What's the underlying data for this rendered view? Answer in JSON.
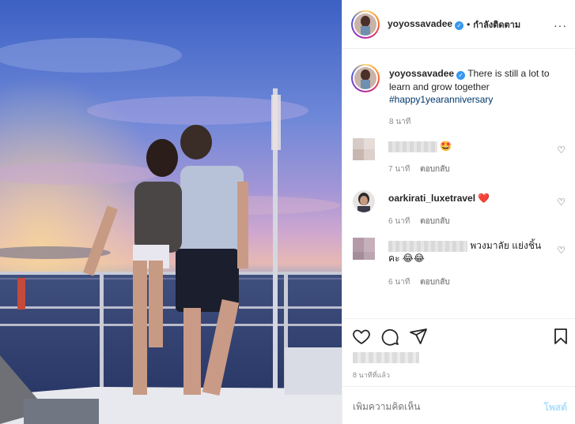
{
  "post": {
    "author": "yoyossavadee",
    "follow_separator": "•",
    "follow_label": "กำลังติดตาม",
    "more_glyph": "···",
    "caption_text": "There is still a lot to learn and grow together",
    "caption_hashtag": "#happy1yearanniversary",
    "caption_time": "8 นาที"
  },
  "comments": [
    {
      "username": "",
      "text": "🤩",
      "time": "7 นาที",
      "reply": "ตอบกลับ"
    },
    {
      "username": "oarkirati_luxetravel",
      "text": "❤️",
      "time": "6 นาที",
      "reply": "ตอบกลับ"
    },
    {
      "username": "",
      "text": "พวงมาลัย แย่งชิ้นคะ 😂😂",
      "time": "6 นาที",
      "reply": "ตอบกลับ"
    }
  ],
  "actions": {
    "posted_ago": "8 นาทีที่แล้ว"
  },
  "add_comment": {
    "placeholder": "เพิ่มความคิดเห็น",
    "post_label": "โพสต์"
  },
  "colors": {
    "verified": "#3897f0",
    "hashtag": "#00376b",
    "muted": "#8e8e8e",
    "post_disabled": "#b2dffc"
  }
}
